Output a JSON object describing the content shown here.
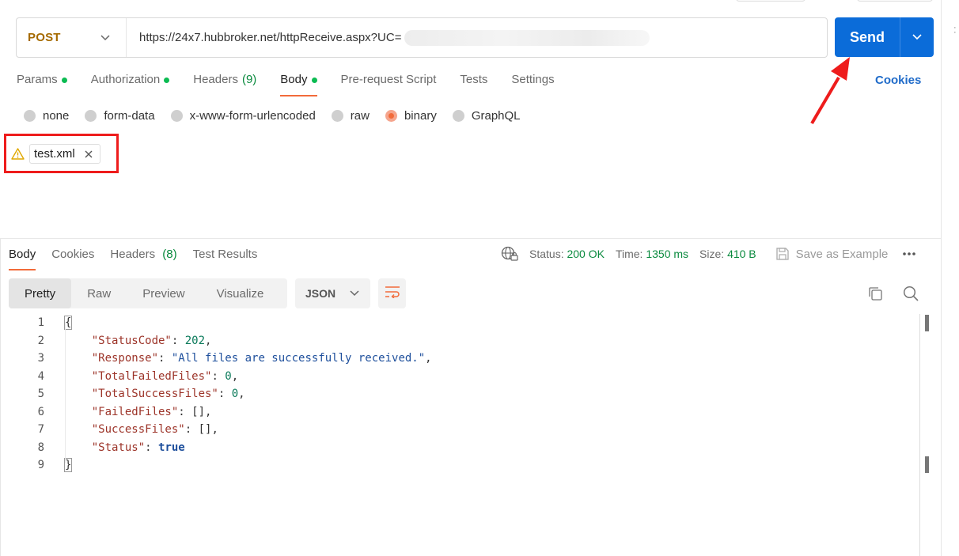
{
  "request": {
    "method": "POST",
    "url": "https://24x7.hubbroker.net/httpReceive.aspx?UC=",
    "send_label": "Send"
  },
  "request_tabs": [
    {
      "label": "Params",
      "dot": true
    },
    {
      "label": "Authorization",
      "dot": true
    },
    {
      "label": "Headers",
      "count": "(9)"
    },
    {
      "label": "Body",
      "dot": true,
      "active": true
    },
    {
      "label": "Pre-request Script"
    },
    {
      "label": "Tests"
    },
    {
      "label": "Settings"
    }
  ],
  "cookies_link": "Cookies",
  "body_types": [
    "none",
    "form-data",
    "x-www-form-urlencoded",
    "raw",
    "binary",
    "GraphQL"
  ],
  "body_type_selected": "binary",
  "file_chip": {
    "name": "test.xml"
  },
  "response_tabs": [
    {
      "label": "Body",
      "active": true
    },
    {
      "label": "Cookies"
    },
    {
      "label": "Headers",
      "count": "(8)"
    },
    {
      "label": "Test Results"
    }
  ],
  "response_meta": {
    "status_label": "Status:",
    "status_value": "200 OK",
    "time_label": "Time:",
    "time_value": "1350 ms",
    "size_label": "Size:",
    "size_value": "410 B",
    "save_example": "Save as Example"
  },
  "view_modes": [
    "Pretty",
    "Raw",
    "Preview",
    "Visualize"
  ],
  "view_mode_selected": "Pretty",
  "format": "JSON",
  "code_lines": [
    {
      "n": "1",
      "html": "<span class=\"brace-box\">{</span>"
    },
    {
      "n": "2",
      "html": "    <span class=\"k\">\"StatusCode\"</span>: <span class=\"n\">202</span>,"
    },
    {
      "n": "3",
      "html": "    <span class=\"k\">\"Response\"</span>: <span class=\"s\">\"All files are successfully received.\"</span>,"
    },
    {
      "n": "4",
      "html": "    <span class=\"k\">\"TotalFailedFiles\"</span>: <span class=\"n\">0</span>,"
    },
    {
      "n": "5",
      "html": "    <span class=\"k\">\"TotalSuccessFiles\"</span>: <span class=\"n\">0</span>,"
    },
    {
      "n": "6",
      "html": "    <span class=\"k\">\"FailedFiles\"</span>: [],"
    },
    {
      "n": "7",
      "html": "    <span class=\"k\">\"SuccessFiles\"</span>: [],"
    },
    {
      "n": "8",
      "html": "    <span class=\"k\">\"Status\"</span>: <span class=\"b\">true</span>"
    },
    {
      "n": "9",
      "html": "<span class=\"brace-box\">}</span>"
    }
  ],
  "colors": {
    "accent": "#f26b3a",
    "send": "#0b6cd9",
    "method": "#a56a00",
    "success": "#0a8a3e",
    "annotation": "#ee1c1c"
  }
}
